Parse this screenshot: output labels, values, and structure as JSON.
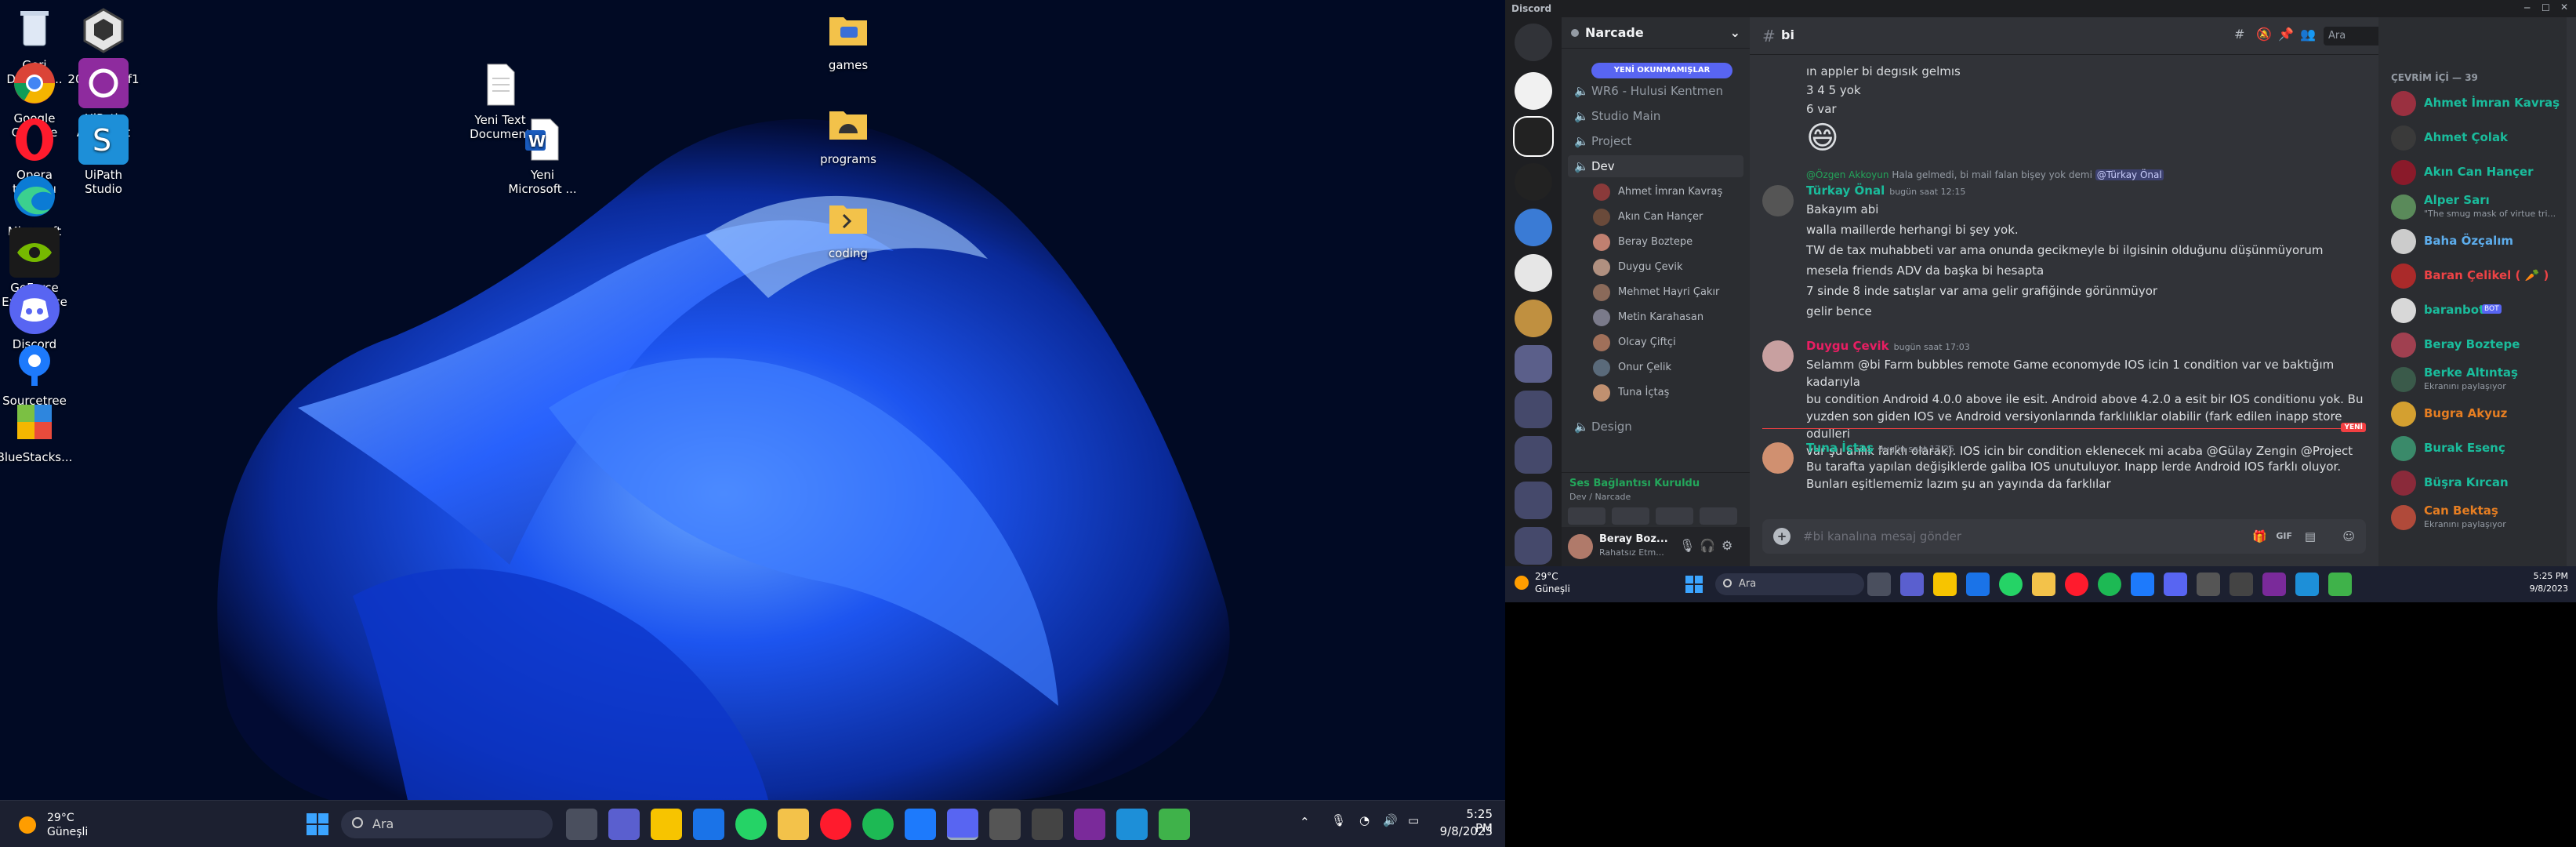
{
  "desktop": {
    "icons": [
      {
        "label": "Geri Dönüşü...",
        "icon": "recycle-bin-icon"
      },
      {
        "label": "Unity 2021.3.15f1",
        "icon": "unity-icon"
      },
      {
        "label": "Google Chrome",
        "icon": "chrome-icon"
      },
      {
        "label": "UiPath Assistant",
        "icon": "uipath-assistant-icon"
      },
      {
        "label": "Opera tarayıcı",
        "icon": "opera-icon"
      },
      {
        "label": "UiPath Studio",
        "icon": "uipath-studio-icon"
      },
      {
        "label": "Microsoft Edge",
        "icon": "edge-icon"
      },
      {
        "label": "GeForce Experience",
        "icon": "geforce-icon"
      },
      {
        "label": "Discord",
        "icon": "discord-icon"
      },
      {
        "label": "Sourcetree",
        "icon": "sourcetree-icon"
      },
      {
        "label": "BlueStacks...",
        "icon": "bluestacks-icon"
      },
      {
        "label": "Yeni Text Document",
        "icon": "text-file-icon"
      },
      {
        "label": "Yeni Microsoft ...",
        "icon": "word-file-icon"
      },
      {
        "label": "games",
        "icon": "folder-icon"
      },
      {
        "label": "programs",
        "icon": "folder-icon"
      },
      {
        "label": "coding",
        "icon": "folder-icon"
      }
    ],
    "colors": {
      "wallpaper_dark": "#010a24",
      "wallpaper_blue": "#1a4dff",
      "taskbar": "#1c2030"
    }
  },
  "taskbar_left": {
    "weather_temp": "29°C",
    "weather_desc": "Güneşli",
    "search_placeholder": "Ara",
    "time": "5:25 PM",
    "date": "9/8/2023"
  },
  "discord": {
    "window_title": "Discord",
    "server_name": "Narcade",
    "unread_banner": "YENİ OKUNMAMIŞLAR",
    "channels": [
      {
        "name": "WR6 - Hulusi Kentmen",
        "type": "voice"
      },
      {
        "name": "Studio Main",
        "type": "voice"
      },
      {
        "name": "Project",
        "type": "voice"
      },
      {
        "name": "Dev",
        "type": "voice"
      }
    ],
    "voice_members": [
      "Ahmet İmran Kavraş",
      "Akın Can Hançer",
      "Beray Boztepe",
      "Duygu Çevik",
      "Mehmet Hayri Çakır",
      "Metin Karahasan",
      "Olcay Çiftçi",
      "Onur Çelik",
      "Tuna İçtaş"
    ],
    "design_channel": "Design",
    "voice_status": "Ses Bağlantısı Kuruldu",
    "voice_location": "Dev / Narcade",
    "user_name": "Beray Boz...",
    "user_status": "Rahatsız Etm...",
    "current_channel": "bi",
    "search_placeholder": "Ara",
    "messages": [
      {
        "text": "ın appler bi degısık gelmıs"
      },
      {
        "text": "3 4 5 yok"
      },
      {
        "text": "6 var"
      },
      {
        "reply_author": "@Özgen Akkoyun",
        "reply_text": "Hala gelmedi, bi mail falan bişey yok demi",
        "reply_mention": "@Türkay Önal"
      },
      {
        "author": "Türkay Önal",
        "time": "bugün saat 12:15",
        "lines": [
          "Bakayım abi",
          "walla maillerde herhangi bi şey yok.",
          "TW de tax muhabbeti var ama onunda gecikmeyle bi ilgisinin olduğunu düşünmüyorum",
          "mesela friends ADV da başka bi hesapta",
          "7 sinde 8 inde satışlar var ama gelir grafiğinde görünmüyor",
          "gelir bence"
        ]
      },
      {
        "author": "Duygu Çevik",
        "time": "bugün saat 17:03",
        "lines": [
          "Selamm @bi Farm bubbles remote Game economyde IOS icin 1 condition var ve baktığım kadarıyla",
          "bu condition  Android 4.0.0 above ile esit. Android above 4.2.0 a esit bir IOS conditionu yok. Bu",
          "yuzden son giden IOS ve Android versiyonlarında farklılıklar olabilir (fark edilen inapp store odulleri",
          "var şu anlık farklı olarak). IOS icin bir condition eklenecek mi acaba @Gülay Zengin @Project"
        ]
      },
      {
        "new_marker": "YENİ"
      },
      {
        "author": "Tuna İçtaş",
        "time": "bugün saat 17:25",
        "lines": [
          "Bu tarafta yapılan değişiklerde galiba IOS unutuluyor. Inapp lerde Android IOS farklı oluyor.",
          "Bunları eşitlememiz lazım şu an yayında da farklılar"
        ]
      }
    ],
    "composer_placeholder": "#bi kanalına mesaj gönder",
    "members_header": "ÇEVRİM İÇİ — 39",
    "members": [
      {
        "name": "Ahmet İmran Kavraş",
        "color": "#1abc9c",
        "sub": ""
      },
      {
        "name": "Ahmet Çolak",
        "color": "#1abc9c",
        "sub": ""
      },
      {
        "name": "Akın Can Hançer",
        "color": "#1abc9c",
        "sub": ""
      },
      {
        "name": "Alper Sarı",
        "color": "#1abc9c",
        "sub": "\"The smug mask of virtue tri..."
      },
      {
        "name": "Baha Özçalım",
        "color": "#5dadec",
        "sub": ""
      },
      {
        "name": "Baran Çelikel ( 🥕 )",
        "color": "#ed4245",
        "sub": ""
      },
      {
        "name": "baranbot",
        "color": "#1abc9c",
        "sub": "",
        "bot": "BOT"
      },
      {
        "name": "Beray Boztepe",
        "color": "#1abc9c",
        "sub": ""
      },
      {
        "name": "Berke Altıntaş",
        "color": "#1abc9c",
        "sub": "Ekranını paylaşıyor"
      },
      {
        "name": "Bugra Akyuz",
        "color": "#e67e22",
        "sub": ""
      },
      {
        "name": "Burak Esenç",
        "color": "#1abc9c",
        "sub": ""
      },
      {
        "name": "Büşra Kırcan",
        "color": "#1abc9c",
        "sub": ""
      },
      {
        "name": "Can Bektaş",
        "color": "#e67e22",
        "sub": "Ekranını paylaşıyor"
      }
    ]
  },
  "taskbar_right": {
    "weather_temp": "29°C",
    "weather_desc": "Güneşli",
    "search_placeholder": "Ara",
    "time": "5:25 PM",
    "date": "9/8/2023"
  }
}
